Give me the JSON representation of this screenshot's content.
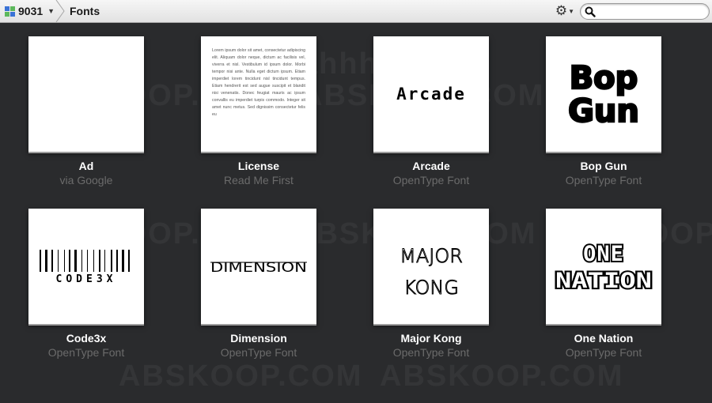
{
  "toolbar": {
    "repo_label": "9031",
    "breadcrumb": "Fonts",
    "search": {
      "value": "",
      "placeholder": ""
    }
  },
  "watermark": [
    "ahhhfs",
    "ABSKOOP.COM"
  ],
  "colors": {
    "background": "#2a2b2d",
    "tile_title": "#ffffff",
    "tile_subtitle": "#6b6b6b",
    "repo_icon": [
      "#3a73d6",
      "#5cb85c",
      "#5cb85c",
      "#3a73d6"
    ]
  },
  "files": [
    {
      "name": "Ad",
      "subtitle": "via Google",
      "preview": ""
    },
    {
      "name": "License",
      "subtitle": "Read Me First",
      "preview": "Lorem ipsum dolor sit amet, consectetur adipiscing elit. Aliquam dolor neque, dictum ac facilisis vel, viverra et nisl. Vestibulum id ipsum dolor. Morbi tempor nisi ante. Nulla eget dictum ipsum. Etiam imperdiet lorem tincidunt nisl tincidunt tempus. Etiam hendrerit est sed augue suscipit et blandit nisi venenatis. Donec feugiat mauris ac ipsum convallis eu imperdiet turpis commodo. Integer sit amet nunc metus. Sed dignissim consectetur felis eu"
    },
    {
      "name": "Arcade",
      "subtitle": "OpenType Font",
      "preview": "Arcade"
    },
    {
      "name": "Bop Gun",
      "subtitle": "OpenType Font",
      "preview": [
        "Bop",
        "Gun"
      ]
    },
    {
      "name": "Code3x",
      "subtitle": "OpenType Font",
      "preview": "CODE3X"
    },
    {
      "name": "Dimension",
      "subtitle": "OpenType Font",
      "preview": "DIMENSION"
    },
    {
      "name": "Major Kong",
      "subtitle": "OpenType Font",
      "preview": [
        "MAJOR",
        "KONG"
      ]
    },
    {
      "name": "One Nation",
      "subtitle": "OpenType Font",
      "preview": [
        "ONE",
        "NATION"
      ]
    }
  ]
}
